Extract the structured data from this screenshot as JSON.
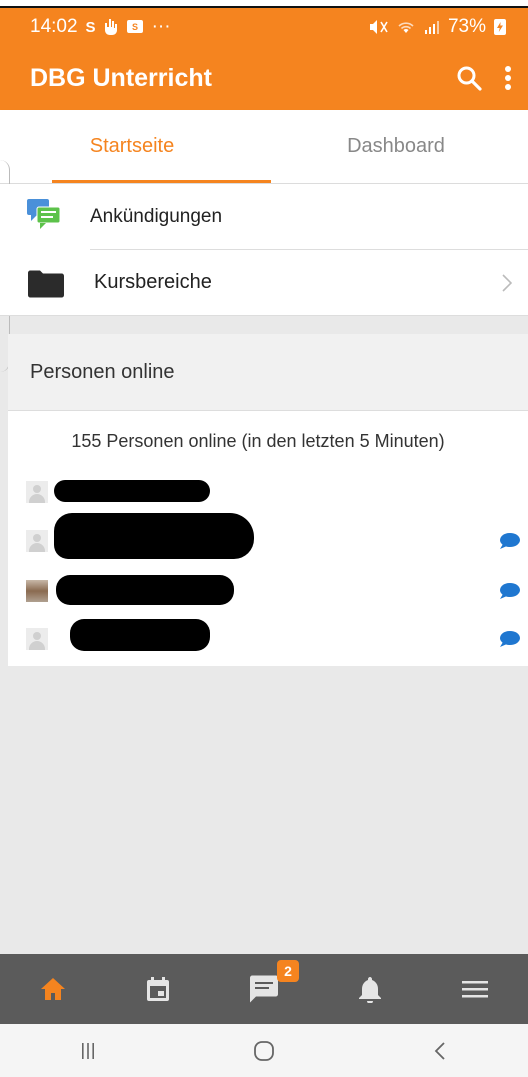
{
  "status_bar": {
    "time": "14:02",
    "notification_icons": [
      "S",
      "hand-icon",
      "mail-icon"
    ],
    "more": "···",
    "battery": "73%"
  },
  "app_bar": {
    "title": "DBG Unterricht",
    "search_icon": "search-icon",
    "menu_icon": "more-vert-icon"
  },
  "tabs": [
    {
      "label": "Startseite",
      "active": true
    },
    {
      "label": "Dashboard",
      "active": false
    }
  ],
  "menu": {
    "items": [
      {
        "label": "Ankündigungen",
        "icon": "forum-icon"
      },
      {
        "label": "Kursbereiche",
        "icon": "folder-icon"
      }
    ]
  },
  "online": {
    "header": "Personen online",
    "summary": "155 Personen online (in den letzten 5 Minuten)",
    "users": [
      {
        "avatar": "default",
        "message": false
      },
      {
        "avatar": "default",
        "message": true
      },
      {
        "avatar": "photo",
        "message": true
      },
      {
        "avatar": "default",
        "message": true
      }
    ]
  },
  "bottom_tabs": [
    {
      "icon": "home-icon",
      "active": true
    },
    {
      "icon": "calendar-icon",
      "active": false
    },
    {
      "icon": "messages-icon",
      "badge": "2"
    },
    {
      "icon": "bell-icon",
      "active": false
    },
    {
      "icon": "hamburger-icon",
      "active": false
    }
  ],
  "colors": {
    "accent": "#f5841f",
    "link": "#2a6ad1",
    "message_icon": "#1f77d0"
  }
}
